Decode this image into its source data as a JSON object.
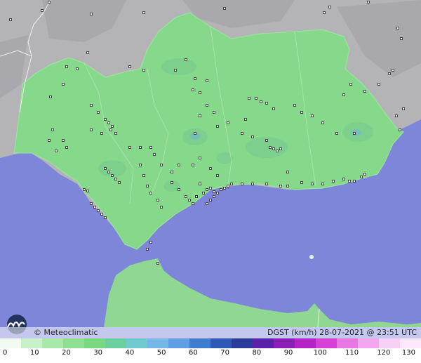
{
  "attribution": "© Meteoclimatic",
  "caption": "DGST (km/h)   28-07-2021 @ 23:51 UTC",
  "colors": {
    "sea": "#7d86d8",
    "land_outside": "#b3b3b5",
    "region": "#86d98b",
    "africa": "#8fd792"
  },
  "scale": {
    "ticks": [
      "0",
      "10",
      "20",
      "30",
      "40",
      "50",
      "60",
      "70",
      "80",
      "90",
      "100",
      "110",
      "120",
      "130"
    ],
    "colors": [
      "#f1fbf1",
      "#c9f1c9",
      "#a9e8ab",
      "#8ddf91",
      "#79d983",
      "#6ccfa0",
      "#70c9cd",
      "#75b8e8",
      "#5e9fe6",
      "#3f7ecf",
      "#2d5ab7",
      "#2a3b9a",
      "#5a22a8",
      "#8a1fb6",
      "#b323c6",
      "#d640d6",
      "#e777e1",
      "#f2a7ee",
      "#f8d0f6",
      "#fde7fd"
    ]
  },
  "station_count": 140,
  "icon": "meteoclimatic-logo-icon"
}
